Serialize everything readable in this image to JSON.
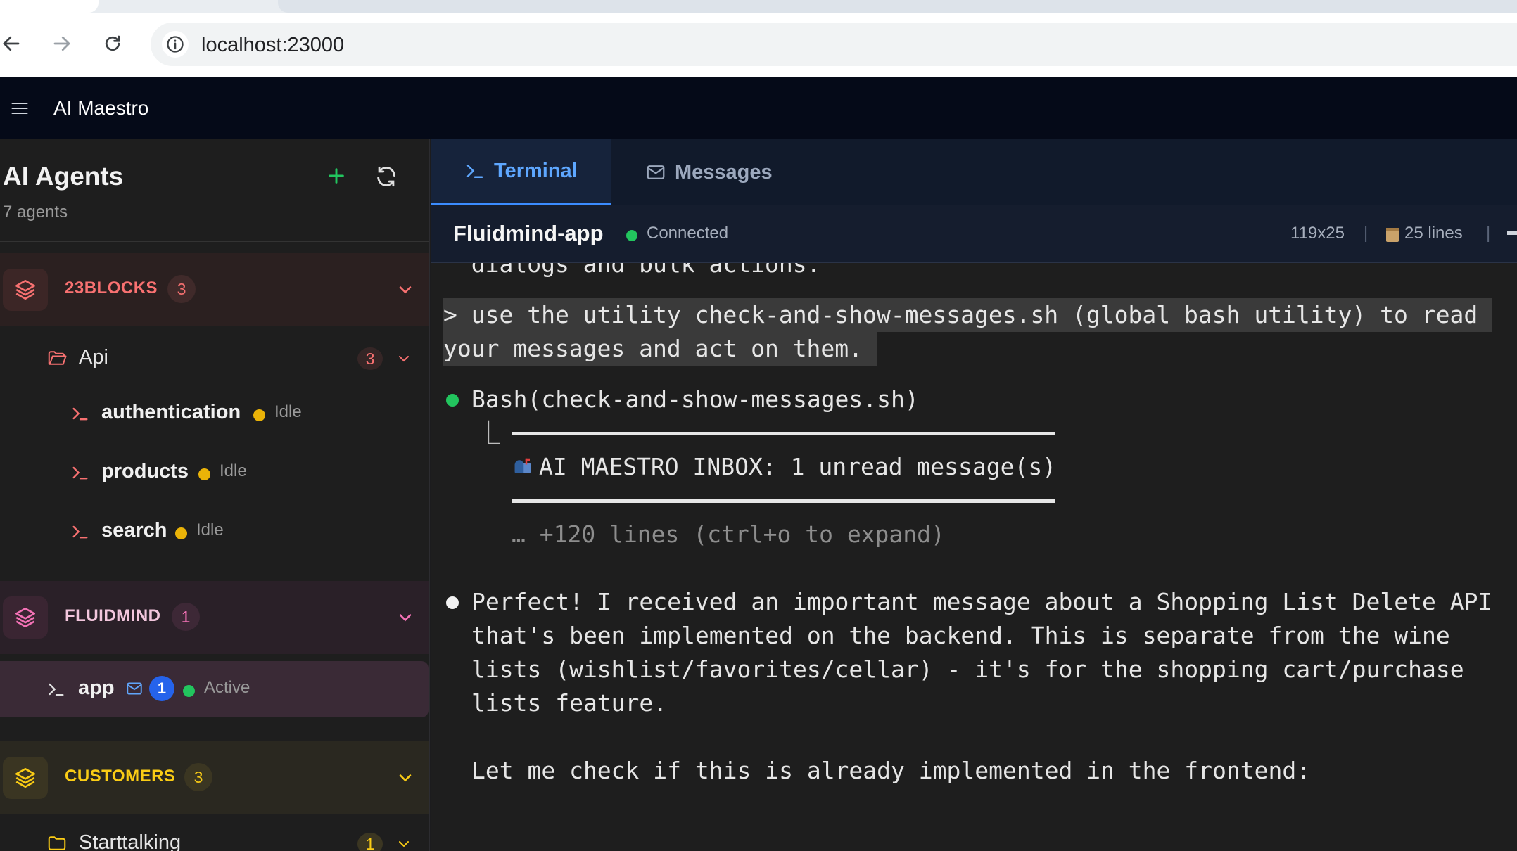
{
  "browser": {
    "url": "localhost:23000",
    "back_icon": "arrow-left-icon",
    "forward_icon": "arrow-right-icon",
    "reload_icon": "reload-icon",
    "info_icon": "info-icon"
  },
  "app": {
    "title": "AI Maestro",
    "menu_icon": "hamburger-menu-icon"
  },
  "sidebar": {
    "heading": "AI Agents",
    "agent_count_label": "7 agents",
    "add_icon": "plus-icon",
    "refresh_icon": "refresh-icon",
    "groups": [
      {
        "name": "23BLOCKS",
        "count": "3",
        "color": "#f87171",
        "subgroups": [
          {
            "name": "Api",
            "count": "3",
            "agents": [
              {
                "name": "authentication",
                "status": "Idle"
              },
              {
                "name": "products",
                "status": "Idle"
              },
              {
                "name": "search",
                "status": "Idle"
              }
            ]
          }
        ]
      },
      {
        "name": "FLUIDMIND",
        "count": "1",
        "color": "#f472b6",
        "agents": [
          {
            "name": "app",
            "unread": "1",
            "status": "Active"
          }
        ]
      },
      {
        "name": "CUSTOMERS",
        "count": "3",
        "color": "#facc15",
        "subgroups": [
          {
            "name": "Starttalking",
            "count": "1"
          }
        ]
      }
    ]
  },
  "main": {
    "tabs": [
      {
        "label": "Terminal",
        "icon": "terminal-prompt-icon",
        "active": true
      },
      {
        "label": "Messages",
        "icon": "envelope-icon",
        "active": false
      }
    ],
    "session": {
      "name": "Fluidmind-app",
      "connection": "Connected",
      "dimensions": "119x25",
      "lines": "25 lines"
    },
    "terminal": {
      "lines": [
        "  dialogs and bulk actions.",
        "> use the utility check-and-show-messages.sh (global bash utility) to read ",
        "your messages and act on them. ",
        "Bash(check-and-show-messages.sh)",
        "⎿",
        "AI MAESTRO INBOX: 1 unread message(s)",
        "… +120 lines (ctrl+o to expand)",
        "Perfect! I received an important message about a Shopping List Delete API",
        "that's been implemented on the backend. This is separate from the wine",
        "lists (wishlist/favorites/cellar) - it's for the shopping cart/purchase",
        "lists feature.",
        "Let me check if this is already implemented in the frontend:"
      ]
    }
  }
}
